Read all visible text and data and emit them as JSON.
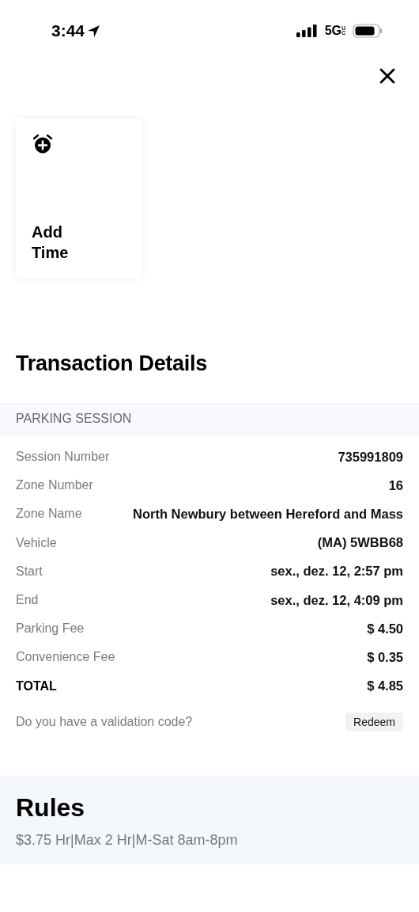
{
  "status_bar": {
    "time": "3:44",
    "network": "5G",
    "network_suffix": "UC"
  },
  "action_card": {
    "label": "Add Time"
  },
  "title": "Transaction Details",
  "section_header": "PARKING SESSION",
  "rows": [
    {
      "kind": "detail",
      "label": "Session Number",
      "value": "735991809"
    },
    {
      "kind": "detail",
      "label": "Zone Number",
      "value": "16"
    },
    {
      "kind": "detail",
      "label": "Zone Name",
      "value": "North Newbury between Hereford and Mass"
    },
    {
      "kind": "detail",
      "label": "Vehicle",
      "value": "(MA) 5WBB68"
    },
    {
      "kind": "detail",
      "label": "Start",
      "value": "sex., dez. 12, 2:57 pm"
    },
    {
      "kind": "detail",
      "label": "End",
      "value": "sex., dez. 12, 4:09 pm"
    },
    {
      "kind": "detail",
      "label": "Parking Fee",
      "value": "$ 4.50"
    },
    {
      "kind": "detail",
      "label": "Convenience Fee",
      "value": "$ 0.35"
    },
    {
      "kind": "total",
      "label": "TOTAL",
      "value": "$ 4.85"
    }
  ],
  "validation": {
    "prompt": "Do you have a validation code?",
    "button": "Redeem"
  },
  "rules": {
    "title": "Rules",
    "text": "$3.75 Hr|Max 2 Hr|M-Sat 8am-8pm"
  }
}
